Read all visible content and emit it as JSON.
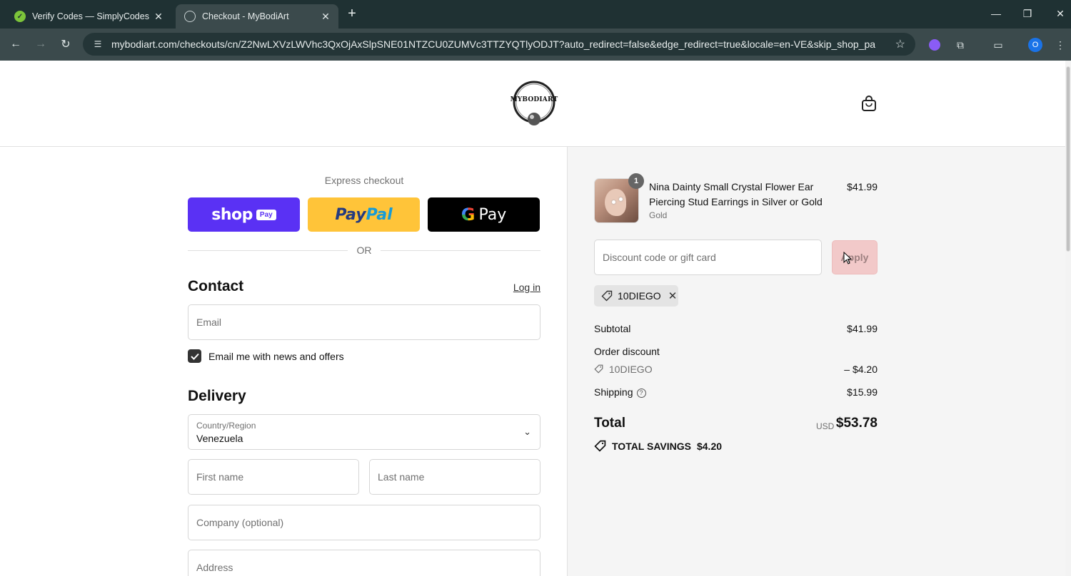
{
  "browser": {
    "tabs": [
      {
        "title": "Verify Codes — SimplyCodes",
        "favicon": "simplycodes-check-icon",
        "active": false
      },
      {
        "title": "Checkout - MyBodiArt",
        "favicon": "globe-icon",
        "active": true
      }
    ],
    "new_tab_label": "+",
    "url": "mybodiart.com/checkouts/cn/Z2NwLXVzLWVhc3QxOjAxSlpSNE01NTZCU0ZUMVc3TTZYQTlyODJT?auto_redirect=false&edge_redirect=true&locale=en-VE&skip_shop_pay=true",
    "profile_initial": "O"
  },
  "header": {
    "logo_text": "MYBODIART"
  },
  "express": {
    "label": "Express checkout",
    "shop_pay": {
      "word": "shop",
      "pill": "Pay"
    },
    "paypal": {
      "part1": "Pay",
      "part2": "Pal"
    },
    "gpay": {
      "g": "G",
      "word": "Pay"
    },
    "or": "OR"
  },
  "contact": {
    "title": "Contact",
    "login": "Log in",
    "email_placeholder": "Email",
    "newsletter_label": "Email me with news and offers",
    "newsletter_checked": true
  },
  "delivery": {
    "title": "Delivery",
    "country_label": "Country/Region",
    "country_value": "Venezuela",
    "first_name_placeholder": "First name",
    "last_name_placeholder": "Last name",
    "company_placeholder": "Company (optional)",
    "address_placeholder": "Address"
  },
  "summary": {
    "item": {
      "quantity": "1",
      "title": "Nina Dainty Small Crystal Flower Ear Piercing Stud Earrings in Silver or Gold",
      "variant": "Gold",
      "price": "$41.99"
    },
    "discount_placeholder": "Discount code or gift card",
    "apply_label": "Apply",
    "applied_code": "10DIEGO",
    "subtotal_label": "Subtotal",
    "subtotal_value": "$41.99",
    "order_discount_label": "Order discount",
    "order_discount_code": "10DIEGO",
    "order_discount_value": "– $4.20",
    "shipping_label": "Shipping",
    "shipping_value": "$15.99",
    "total_label": "Total",
    "total_currency": "USD",
    "total_value": "$53.78",
    "savings_label": "TOTAL SAVINGS",
    "savings_value": "$4.20"
  },
  "colors": {
    "shop_pay": "#5a31f4",
    "paypal": "#ffc439",
    "gpay": "#000000",
    "apply_disabled": "#f2c9c9",
    "browser_frame": "#1f3133"
  }
}
